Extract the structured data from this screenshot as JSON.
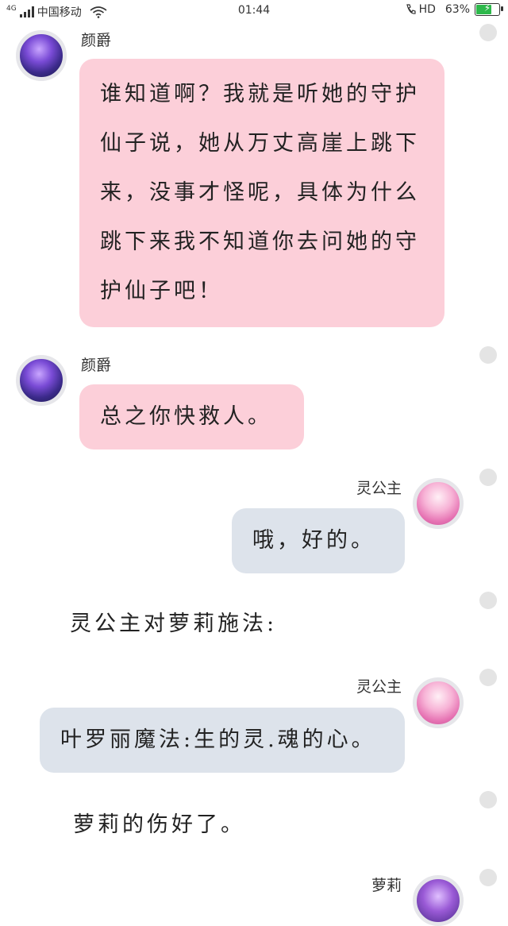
{
  "status_bar": {
    "network": "4G",
    "carrier": "中国移动",
    "time": "01:44",
    "hd": "HD",
    "battery_percent": "63%",
    "battery_level": 0.63,
    "battery_color": "#2db84b"
  },
  "colors": {
    "pink_bubble": "#fccfd9",
    "blue_bubble": "#dde3eb",
    "dot": "#e4e4e4"
  },
  "messages": [
    {
      "sender": "颜爵",
      "text": "谁知道啊？我就是听她的守护仙子说，她从万丈高崖上跳下来，没事才怪呢，具体为什么跳下来我不知道你去问她的守护仙子吧！"
    },
    {
      "sender": "颜爵",
      "text": "总之你快救人。"
    },
    {
      "sender": "灵公主",
      "text": "哦，好的。"
    },
    {
      "narration": "灵公主对萝莉施法:"
    },
    {
      "sender": "灵公主",
      "text": "叶罗丽魔法:生的灵.魂的心。"
    },
    {
      "narration": "萝莉的伤好了。"
    },
    {
      "sender": "萝莉"
    }
  ]
}
